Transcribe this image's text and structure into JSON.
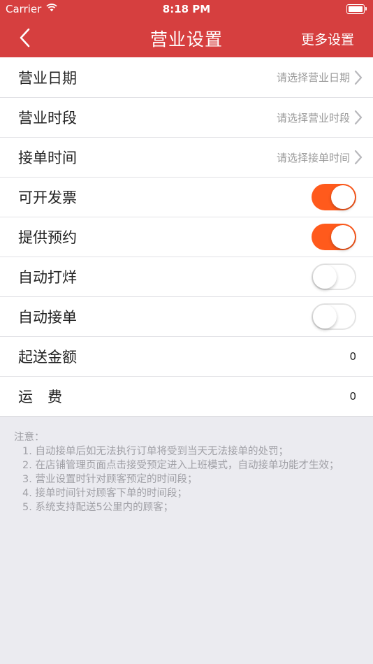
{
  "status_bar": {
    "carrier": "Carrier",
    "time": "8:18 PM"
  },
  "nav": {
    "title": "营业设置",
    "more": "更多设置",
    "back_icon": "chevron-left-icon"
  },
  "colors": {
    "header": "#d63f3f",
    "toggle_on": "#ff5a1c"
  },
  "rows": [
    {
      "label": "营业日期",
      "placeholder": "请选择营业日期"
    },
    {
      "label": "营业时段",
      "placeholder": "请选择营业时段"
    },
    {
      "label": "接单时间",
      "placeholder": "请选择接单时间"
    },
    {
      "label": "可开发票",
      "toggle": true
    },
    {
      "label": "提供预约",
      "toggle": true
    },
    {
      "label": "自动打烊",
      "toggle": false
    },
    {
      "label": "自动接单",
      "toggle": false
    },
    {
      "label": "起送金额",
      "value": "0"
    },
    {
      "label": "运　费",
      "value": "0"
    }
  ],
  "notes": {
    "title": "注意：",
    "items": [
      "1. 自动接单后如无法执行订单将受到当天无法接单的处罚；",
      "2. 在店铺管理页面点击接受预定进入上班模式，自动接单功能才生效；",
      "3. 营业设置时针对顾客预定的时间段；",
      "4. 接单时间针对顾客下单的时间段；",
      "5. 系统支持配送5公里内的顾客；"
    ]
  }
}
